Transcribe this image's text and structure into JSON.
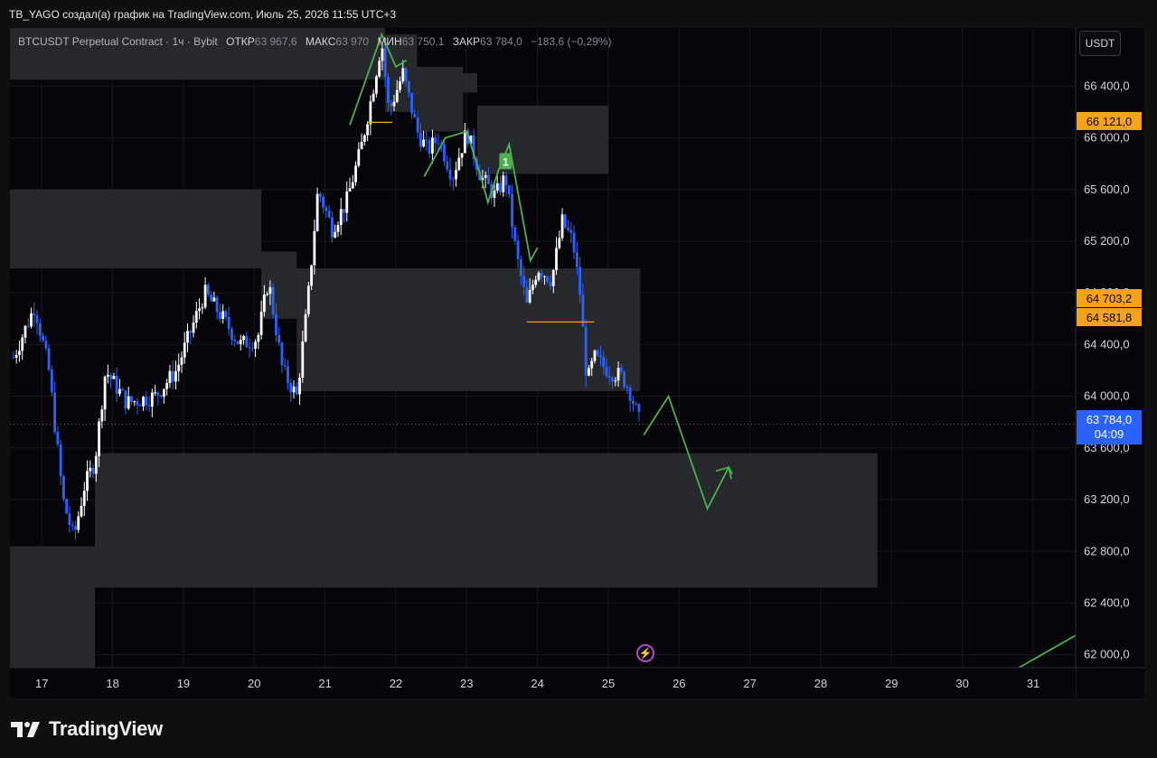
{
  "header": {
    "title": "TB_YAGO создал(а) график на TradingView.com, Июль 25, 2026 11:55 UTC+3"
  },
  "legend": {
    "symbol": "BTCUSDT Perpetual Contract · 1ч · Bybit",
    "open_label": "ОТКР",
    "open_value": "63 967,6",
    "high_label": "МАКС",
    "high_value": "63 970",
    "low_label": "МИН",
    "low_value": "63 750,1",
    "close_label": "ЗАКР",
    "close_value": "63 784,0",
    "change": "−183,6 (−0,29%)"
  },
  "currency_button": "USDT",
  "price_tags": {
    "resistance": "66 121,0",
    "level_a": "64 703,2",
    "level_b": "64 581,8",
    "current_price": "63 784,0",
    "countdown": "04:09"
  },
  "lightning_icon": "lightning-icon",
  "footer": {
    "brand": "TradingView"
  },
  "colors": {
    "candle": "#ffffff",
    "candle_down": "#2962ff",
    "projection": "#4caf50",
    "level_line": "#f7a21b",
    "zone": "#2a2b30",
    "current": "#2962ff"
  },
  "chart_data": {
    "type": "candlestick",
    "title": "BTCUSDT Perpetual Contract · 1ч · Bybit",
    "xlabel": "",
    "ylabel": "",
    "x_ticks": [
      "17",
      "18",
      "19",
      "20",
      "21",
      "22",
      "23",
      "24",
      "25",
      "26",
      "27",
      "28",
      "29",
      "30",
      "31"
    ],
    "y_ticks": [
      "66 400,0",
      "66 000,0",
      "65 600,0",
      "65 200,0",
      "64 800,0",
      "64 400,0",
      "64 000,0",
      "63 600,0",
      "63 200,0",
      "62 800,0",
      "62 400,0",
      "62 000,0"
    ],
    "ylim": [
      61900,
      66850
    ],
    "xlim": [
      16.55,
      31.6
    ],
    "grid": true,
    "price_path": [
      [
        16.6,
        64300
      ],
      [
        16.9,
        64700
      ],
      [
        17.1,
        64200
      ],
      [
        17.3,
        63200
      ],
      [
        17.45,
        62900
      ],
      [
        17.6,
        63300
      ],
      [
        17.75,
        63500
      ],
      [
        17.9,
        64200
      ],
      [
        18.2,
        63950
      ],
      [
        18.6,
        64000
      ],
      [
        18.9,
        64200
      ],
      [
        19.1,
        64500
      ],
      [
        19.3,
        64800
      ],
      [
        19.5,
        64650
      ],
      [
        19.8,
        64400
      ],
      [
        20.05,
        64450
      ],
      [
        20.2,
        64900
      ],
      [
        20.4,
        64200
      ],
      [
        20.6,
        64000
      ],
      [
        20.75,
        64700
      ],
      [
        20.9,
        65600
      ],
      [
        21.1,
        65300
      ],
      [
        21.3,
        65500
      ],
      [
        21.5,
        65900
      ],
      [
        21.65,
        66300
      ],
      [
        21.8,
        66750
      ],
      [
        21.9,
        66200
      ],
      [
        22.1,
        66500
      ],
      [
        22.3,
        66050
      ],
      [
        22.45,
        65900
      ],
      [
        22.6,
        66000
      ],
      [
        22.8,
        65700
      ],
      [
        23.0,
        66050
      ],
      [
        23.2,
        65700
      ],
      [
        23.4,
        65550
      ],
      [
        23.55,
        65700
      ],
      [
        23.7,
        65100
      ],
      [
        23.85,
        64700
      ],
      [
        24.0,
        65000
      ],
      [
        24.2,
        64900
      ],
      [
        24.35,
        65350
      ],
      [
        24.5,
        65200
      ],
      [
        24.6,
        64800
      ],
      [
        24.7,
        64100
      ],
      [
        24.8,
        64300
      ],
      [
        25.0,
        64200
      ],
      [
        25.2,
        64150
      ],
      [
        25.3,
        64050
      ],
      [
        25.45,
        63784
      ]
    ],
    "zones": [
      {
        "x0": 16.55,
        "x1": 21.85,
        "y0": 66450,
        "y1": 66850
      },
      {
        "x0": 21.85,
        "x1": 22.3,
        "y0": 66200,
        "y1": 66800
      },
      {
        "x0": 22.3,
        "x1": 22.95,
        "y0": 66050,
        "y1": 66550
      },
      {
        "x0": 22.95,
        "x1": 23.15,
        "y0": 66350,
        "y1": 66500
      },
      {
        "x0": 23.15,
        "x1": 25.0,
        "y0": 65720,
        "y1": 66250
      },
      {
        "x0": 16.55,
        "x1": 20.1,
        "y0": 64990,
        "y1": 65600
      },
      {
        "x0": 20.1,
        "x1": 20.6,
        "y0": 64600,
        "y1": 65120
      },
      {
        "x0": 20.6,
        "x1": 25.45,
        "y0": 64040,
        "y1": 64990
      },
      {
        "x0": 17.75,
        "x1": 28.8,
        "y0": 62520,
        "y1": 63560
      },
      {
        "x0": 16.55,
        "x1": 17.75,
        "y0": 61900,
        "y1": 62840
      }
    ],
    "projection": [
      [
        25.5,
        63700
      ],
      [
        25.85,
        64000
      ],
      [
        26.4,
        63130
      ],
      [
        26.7,
        63450
      ],
      [
        26.75,
        63400
      ]
    ],
    "wave_paths": [
      [
        [
          21.35,
          66100
        ],
        [
          21.8,
          66800
        ],
        [
          22.0,
          66550
        ],
        [
          22.15,
          66600
        ]
      ],
      [
        [
          22.4,
          65700
        ],
        [
          22.7,
          66000
        ],
        [
          23.0,
          66050
        ],
        [
          23.2,
          65700
        ],
        [
          23.3,
          65500
        ],
        [
          23.45,
          65750
        ],
        [
          23.6,
          65950
        ],
        [
          23.9,
          65050
        ],
        [
          24.0,
          65150
        ]
      ]
    ],
    "trend_line": [
      [
        30.8,
        61900
      ],
      [
        31.6,
        62150
      ]
    ],
    "level_lines": [
      {
        "x0": 21.6,
        "x1": 21.95,
        "y": 66120
      },
      {
        "x0": 23.85,
        "x1": 24.8,
        "y": 64575
      }
    ],
    "current_price": 63784,
    "marker": {
      "x": 23.55,
      "y": 65820,
      "label": "1"
    }
  }
}
